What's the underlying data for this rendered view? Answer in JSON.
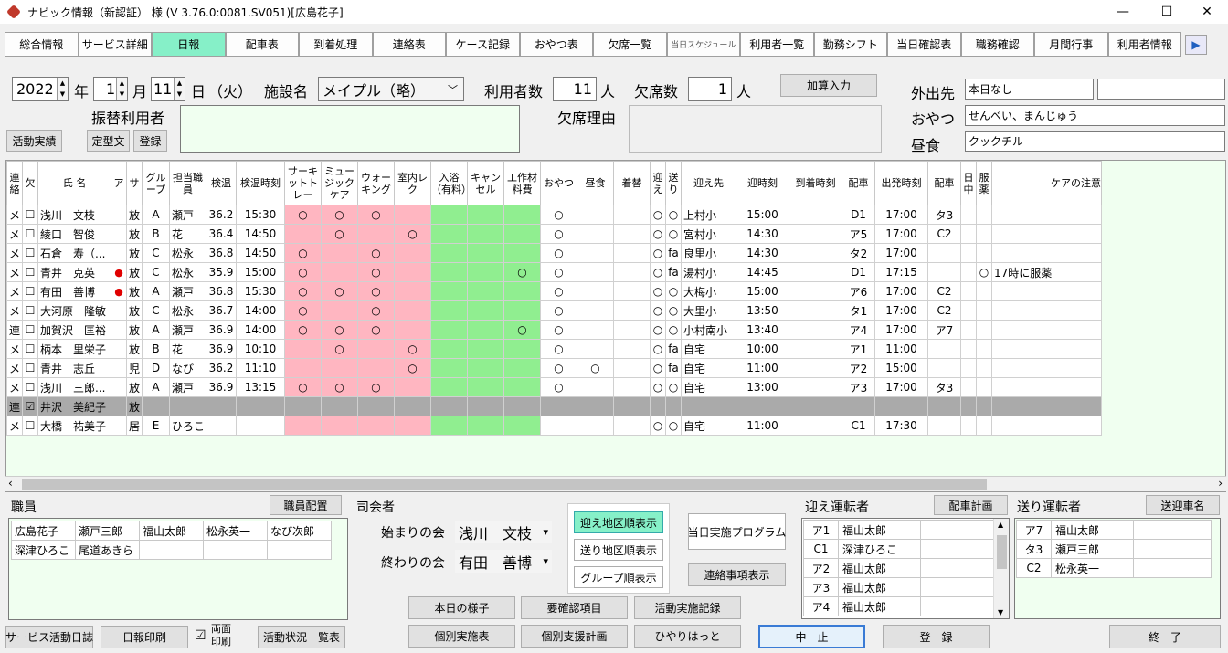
{
  "window": {
    "title": "ナビック情報（新認証） 様 (V 3.76.0:0081.SV051)[広島花子]",
    "min": "—",
    "max": "☐",
    "close": "✕"
  },
  "tabs": [
    "総合情報",
    "サービス詳細",
    "日報",
    "配車表",
    "到着処理",
    "連絡表",
    "ケース記録",
    "おやつ表",
    "欠席一覧",
    "当日スケジュール",
    "利用者一覧",
    "勤務シフト",
    "当日確認表",
    "職務確認",
    "月間行事",
    "利用者情報"
  ],
  "active_tab": "日報",
  "next_arrow": "▶",
  "date": {
    "year": "2022",
    "year_lbl": "年",
    "month": "1",
    "month_lbl": "月",
    "day": "11",
    "day_lbl": "日",
    "weekday": "（火）",
    "spin_up": "▲",
    "spin_down": "▼"
  },
  "facility": {
    "label": "施設名",
    "value": "メイプル（略）",
    "arrow": "﹀"
  },
  "users": {
    "label": "利用者数",
    "value": "11",
    "unit": "人"
  },
  "absent": {
    "label": "欠席数",
    "value": "1",
    "unit": "人"
  },
  "kasan_btn": "加算入力",
  "furikae_label": "振替利用者",
  "absent_reason_label": "欠席理由",
  "btn_katsudo": "活動実績",
  "btn_teikei": "定型文",
  "btn_touroku": "登録",
  "outing": {
    "label": "外出先",
    "value": "本日なし",
    "value2": ""
  },
  "snack": {
    "label": "おやつ",
    "value": "せんべい、まんじゅう"
  },
  "lunch": {
    "label": "昼食",
    "value": "クックチル"
  },
  "grid": {
    "headers": [
      "連絡",
      "欠",
      "氏 名",
      "ア",
      "サ",
      "グループ",
      "担当職員",
      "検温",
      "検温時刻",
      "サーキットトレー",
      "ミュージックケア",
      "ウォーキング",
      "室内レク",
      "入浴（有料）",
      "キャンセル",
      "工作材料費",
      "おやつ",
      "昼食",
      "着替",
      "迎え",
      "送り",
      "迎え先",
      "迎時刻",
      "到着時刻",
      "配車",
      "出発時刻",
      "配車",
      "日中",
      "服薬",
      "ケアの注意"
    ],
    "rows": [
      [
        "メ",
        "☐",
        "浅川　文枝",
        "",
        "放",
        "A",
        "瀬戸",
        "36.2",
        "15:30",
        "○",
        "○",
        "○",
        "",
        "",
        "",
        "",
        "○",
        "",
        "",
        "○",
        "○",
        "上村小",
        "15:00",
        "",
        "D1",
        "17:00",
        "タ3",
        "",
        "",
        ""
      ],
      [
        "メ",
        "☐",
        "綾口　智俊",
        "",
        "放",
        "B",
        "花",
        "36.4",
        "14:50",
        "",
        "○",
        "",
        "○",
        "",
        "",
        "",
        "○",
        "",
        "",
        "○",
        "○",
        "宮村小",
        "14:30",
        "",
        "ア5",
        "17:00",
        "C2",
        "",
        "",
        ""
      ],
      [
        "メ",
        "☐",
        "石倉　寿（...",
        "",
        "放",
        "C",
        "松永",
        "36.8",
        "14:50",
        "○",
        "",
        "○",
        "",
        "",
        "",
        "",
        "○",
        "",
        "",
        "○",
        "fa",
        "良里小",
        "14:30",
        "",
        "タ2",
        "17:00",
        "",
        "",
        "",
        ""
      ],
      [
        "メ",
        "☐",
        "青井　克英",
        "●",
        "放",
        "C",
        "松永",
        "35.9",
        "15:00",
        "○",
        "",
        "○",
        "",
        "",
        "",
        "○",
        "○",
        "",
        "",
        "○",
        "fa",
        "湯村小",
        "14:45",
        "",
        "D1",
        "17:15",
        "",
        "",
        "○",
        "17時に服薬"
      ],
      [
        "メ",
        "☐",
        "有田　善博",
        "●",
        "放",
        "A",
        "瀬戸",
        "36.8",
        "15:30",
        "○",
        "○",
        "○",
        "",
        "",
        "",
        "",
        "○",
        "",
        "",
        "○",
        "○",
        "大梅小",
        "15:00",
        "",
        "ア6",
        "17:00",
        "C2",
        "",
        "",
        ""
      ],
      [
        "メ",
        "☐",
        "大河原　隆敏",
        "",
        "放",
        "C",
        "松永",
        "36.7",
        "14:00",
        "○",
        "",
        "○",
        "",
        "",
        "",
        "",
        "○",
        "",
        "",
        "○",
        "○",
        "大里小",
        "13:50",
        "",
        "タ1",
        "17:00",
        "C2",
        "",
        "",
        ""
      ],
      [
        "連",
        "☐",
        "加賀沢　匡裕",
        "",
        "放",
        "A",
        "瀬戸",
        "36.9",
        "14:00",
        "○",
        "○",
        "○",
        "",
        "",
        "",
        "○",
        "○",
        "",
        "",
        "○",
        "○",
        "小村南小",
        "13:40",
        "",
        "ア4",
        "17:00",
        "ア7",
        "",
        "",
        ""
      ],
      [
        "メ",
        "☐",
        "柄本　里栄子",
        "",
        "放",
        "B",
        "花",
        "36.9",
        "10:10",
        "",
        "○",
        "",
        "○",
        "",
        "",
        "",
        "○",
        "",
        "",
        "○",
        "fa",
        "自宅",
        "10:00",
        "",
        "ア1",
        "11:00",
        "",
        "",
        "",
        ""
      ],
      [
        "メ",
        "☐",
        "青井　志丘",
        "",
        "児",
        "D",
        "なび",
        "36.2",
        "11:10",
        "",
        "",
        "",
        "○",
        "",
        "",
        "",
        "○",
        "○",
        "",
        "○",
        "fa",
        "自宅",
        "11:00",
        "",
        "ア2",
        "15:00",
        "",
        "",
        "",
        ""
      ],
      [
        "メ",
        "☐",
        "浅川　三郎...",
        "",
        "放",
        "A",
        "瀬戸",
        "36.9",
        "13:15",
        "○",
        "○",
        "○",
        "",
        "",
        "",
        "",
        "○",
        "",
        "",
        "○",
        "○",
        "自宅",
        "13:00",
        "",
        "ア3",
        "17:00",
        "タ3",
        "",
        "",
        ""
      ],
      [
        "連",
        "☑",
        "井沢　美紀子",
        "",
        "放",
        "",
        "",
        "",
        "",
        "",
        "",
        "",
        "",
        "",
        "",
        "",
        "",
        "",
        "",
        "",
        "",
        "",
        "",
        "",
        "",
        "",
        "",
        "",
        "",
        ""
      ],
      [
        "メ",
        "☐",
        "大橋　祐美子",
        "",
        "居",
        "E",
        "ひろこ",
        "",
        "",
        "",
        "",
        "",
        "",
        "",
        "",
        "",
        "",
        "",
        "",
        "○",
        "○",
        "自宅",
        "11:00",
        "",
        "C1",
        "17:30",
        "",
        "",
        "",
        ""
      ]
    ]
  },
  "scroll_left": "‹",
  "scroll_right": "›",
  "staff": {
    "label": "職員",
    "btn": "職員配置",
    "rows": [
      [
        "広島花子",
        "瀬戸三郎",
        "福山太郎",
        "松永英一",
        "なび次郎"
      ],
      [
        "深津ひろこ",
        "尾道あきら",
        "",
        "",
        ""
      ]
    ]
  },
  "mc": {
    "label": "司会者",
    "start_label": "始まりの会",
    "start_value": "浅川　文枝",
    "end_label": "終わりの会",
    "end_value": "有田　善博",
    "arrow": "▾"
  },
  "order_btns": [
    "迎え地区順表示",
    "送り地区順表示",
    "グループ順表示"
  ],
  "btn_program": "当日実施プログラム",
  "btn_renraku": "連絡事項表示",
  "pickup": {
    "label": "迎え運転者",
    "btn": "配車計画",
    "rows": [
      [
        "ア1",
        "福山太郎"
      ],
      [
        "C1",
        "深津ひろこ"
      ],
      [
        "ア2",
        "福山太郎"
      ],
      [
        "ア3",
        "福山太郎"
      ],
      [
        "ア4",
        "福山太郎"
      ]
    ],
    "up": "▲",
    "down": "▼"
  },
  "dropoff": {
    "label": "送り運転者",
    "btn": "送迎車名",
    "rows": [
      [
        "ア7",
        "福山太郎"
      ],
      [
        "タ3",
        "瀬戸三郎"
      ],
      [
        "C2",
        "松永英一"
      ]
    ]
  },
  "mid_btns_row1": [
    "本日の様子",
    "要確認項目",
    "活動実施記録"
  ],
  "mid_btns_row2": [
    "個別実施表",
    "個別支援計画",
    "ひやりはっと"
  ],
  "btn_cancel": "中　止",
  "btn_save": "登　録",
  "btn_exit": "終　了",
  "btn_service_log": "サービス活動日誌",
  "btn_print": "日報印刷",
  "duplex": {
    "check": "☑",
    "label1": "両面",
    "label2": "印刷"
  },
  "btn_activity_list": "活動状況一覧表"
}
